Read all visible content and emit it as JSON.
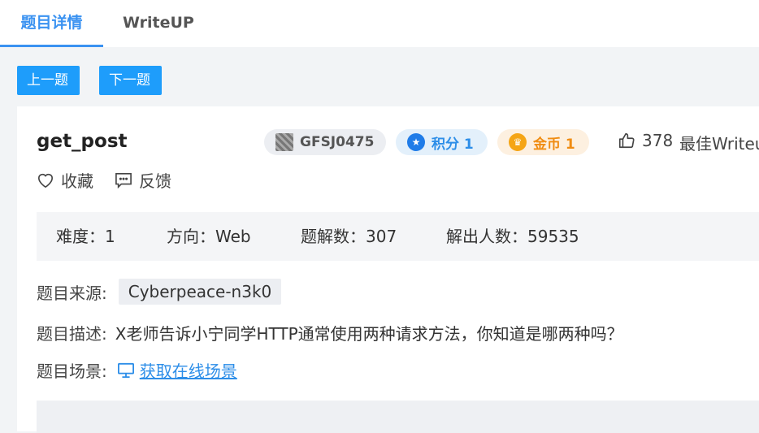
{
  "tabs": {
    "detail": "题目详情",
    "writeup": "WriteUP"
  },
  "nav": {
    "prev": "上一题",
    "next": "下一题"
  },
  "challenge": {
    "title": "get_post",
    "author": "GFSJ0475",
    "score_label": "积分 1",
    "gold_label": "金币 1",
    "likes": "378",
    "best_writeup": "最佳Writeup",
    "collect": "收藏",
    "feedback": "反馈"
  },
  "stats": {
    "difficulty": "难度：1",
    "direction": "方向：Web",
    "solutions": "题解数：307",
    "solvers": "解出人数：59535"
  },
  "info": {
    "source_label": "题目来源:",
    "source_value": "Cyberpeace-n3k0",
    "desc_label": "题目描述:",
    "desc_value": "X老师告诉小宁同学HTTP通常使用两种请求方法，你知道是哪两种吗？",
    "scene_label": "题目场景:",
    "scene_link": "获取在线场景"
  },
  "colors": {
    "accent": "#3a92f1",
    "button": "#1e9dfb",
    "gold": "#f08c12"
  }
}
